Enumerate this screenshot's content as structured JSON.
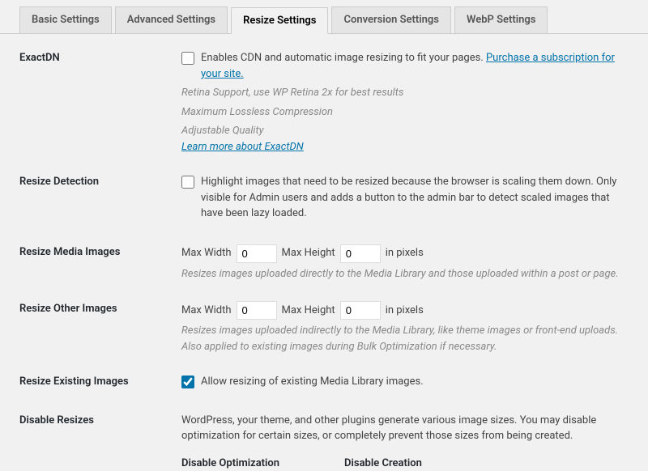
{
  "tabs": [
    {
      "label": "Basic Settings"
    },
    {
      "label": "Advanced Settings"
    },
    {
      "label": "Resize Settings"
    },
    {
      "label": "Conversion Settings"
    },
    {
      "label": "WebP Settings"
    }
  ],
  "rows": {
    "exactdn": {
      "label": "ExactDN",
      "checkbox": "Enables CDN and automatic image resizing to fit your pages.",
      "purchase_link": "Purchase a subscription for your site.",
      "desc1": "Retina Support, use WP Retina 2x for best results",
      "desc2": "Maximum Lossless Compression",
      "desc3": "Adjustable Quality",
      "learn_link": "Learn more about ExactDN"
    },
    "resize_detection": {
      "label": "Resize Detection",
      "checkbox": "Highlight images that need to be resized because the browser is scaling them down. Only visible for Admin users and adds a button to the admin bar to detect scaled images that have been lazy loaded."
    },
    "resize_media": {
      "label": "Resize Media Images",
      "max_width_label": "Max Width",
      "max_width_value": "0",
      "max_height_label": "Max Height",
      "max_height_value": "0",
      "units": "in pixels",
      "desc": "Resizes images uploaded directly to the Media Library and those uploaded within a post or page."
    },
    "resize_other": {
      "label": "Resize Other Images",
      "max_width_label": "Max Width",
      "max_width_value": "0",
      "max_height_label": "Max Height",
      "max_height_value": "0",
      "units": "in pixels",
      "desc": "Resizes images uploaded indirectly to the Media Library, like theme images or front-end uploads. Also applied to existing images during Bulk Optimization if necessary."
    },
    "resize_existing": {
      "label": "Resize Existing Images",
      "checkbox": "Allow resizing of existing Media Library images."
    },
    "disable_resizes": {
      "label": "Disable Resizes",
      "desc": "WordPress, your theme, and other plugins generate various image sizes. You may disable optimization for certain sizes, or completely prevent those sizes from being created.",
      "col1": "Disable Optimization",
      "col2": "Disable Creation"
    }
  }
}
